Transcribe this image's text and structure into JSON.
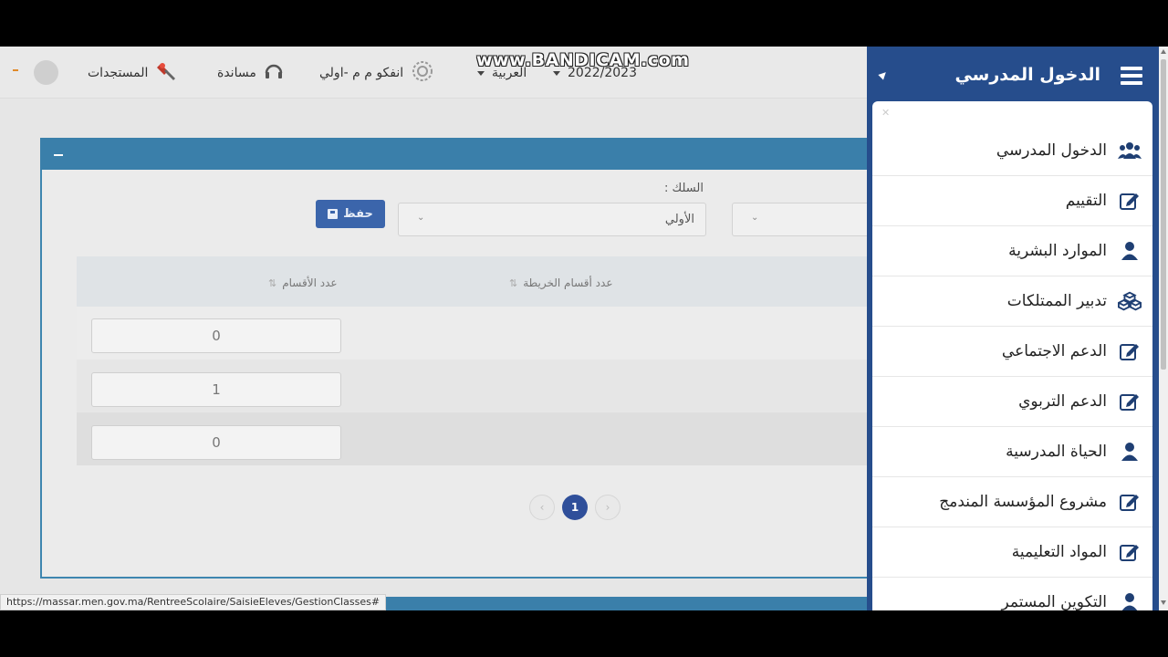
{
  "watermark": "www.BANDICAM.com",
  "header": {
    "news": "المستجدات",
    "support": "مساندة",
    "school": "انفكو م م -اولي",
    "language": "العربية",
    "year": "2022/2023"
  },
  "form": {
    "silk_label": "السلك :",
    "silk_value": "الأولي",
    "save_label": "حفظ"
  },
  "table": {
    "columns": [
      "عدد الأقسام",
      "عدد أقسام الخريطة"
    ],
    "rows": [
      {
        "sections": "0"
      },
      {
        "sections": "1"
      },
      {
        "sections": "0"
      }
    ]
  },
  "pagination": {
    "current": "1",
    "prev": "‹",
    "next": "›"
  },
  "status_url": "https://massar.men.gov.ma/RentreeScolaire/SaisieEleves/GestionClasses#",
  "sidebar": {
    "title": "الدخول المدرسي",
    "items": [
      {
        "label": "الدخول المدرسي",
        "icon": "users-icon"
      },
      {
        "label": "التقييم",
        "icon": "edit-icon"
      },
      {
        "label": "الموارد البشرية",
        "icon": "user-icon"
      },
      {
        "label": "تدبير الممتلكات",
        "icon": "cubes-icon"
      },
      {
        "label": "الدعم الاجتماعي",
        "icon": "edit-icon"
      },
      {
        "label": "الدعم التربوي",
        "icon": "edit-icon"
      },
      {
        "label": "الحياة المدرسية",
        "icon": "user-icon"
      },
      {
        "label": "مشروع المؤسسة المندمج",
        "icon": "edit-icon"
      },
      {
        "label": "المواد التعليمية",
        "icon": "edit-icon"
      },
      {
        "label": "التكوين المستمر",
        "icon": "user-icon"
      }
    ]
  },
  "colors": {
    "sidebar": "#264d8c",
    "panel_header": "#3a7faa",
    "save_button": "#3b65ab",
    "pager_active": "#2f4f9a",
    "menu_icon": "#1f3f73"
  }
}
